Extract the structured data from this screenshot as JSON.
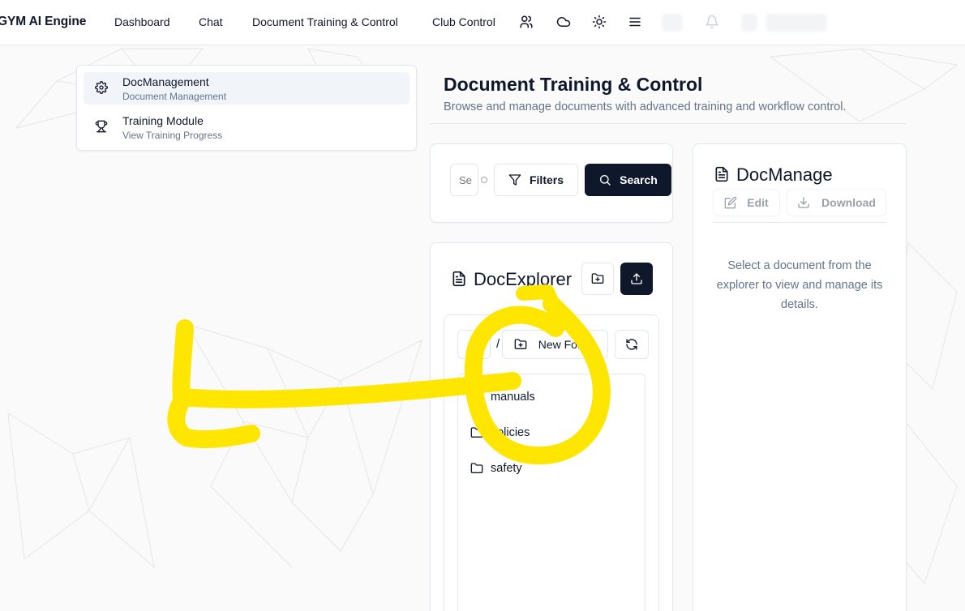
{
  "nav": {
    "brand": "GYM AI Engine",
    "links": [
      "Dashboard",
      "Chat",
      "Document Training & Control",
      "Club Control"
    ],
    "icons": [
      "users-icon",
      "cloud-icon",
      "sun-icon",
      "menu-icon",
      "bell-icon"
    ]
  },
  "sidebar": {
    "items": [
      {
        "title": "DocManagement",
        "subtitle": "Document Management",
        "icon": "gear-icon"
      },
      {
        "title": "Training Module",
        "subtitle": "View Training Progress",
        "icon": "trophy-icon"
      }
    ]
  },
  "header": {
    "title": "Document Training & Control",
    "description": "Browse and manage documents with advanced training and workflow control."
  },
  "search": {
    "placeholder": "Se",
    "filters_label": "Filters",
    "search_label": "Search"
  },
  "explorer": {
    "title": "DocExplorer",
    "up_label": "..",
    "path_separator": "/",
    "new_folder_label": "New Folder",
    "folders": [
      "manuals",
      "policies",
      "safety"
    ]
  },
  "manage": {
    "title": "DocManage",
    "edit_label": "Edit",
    "download_label": "Download",
    "placeholder": "Select a document from the explorer to view and manage its details."
  },
  "colors": {
    "accent_dark": "#0f172a",
    "muted_text": "#64748b",
    "annotation_yellow": "#ffe600"
  }
}
